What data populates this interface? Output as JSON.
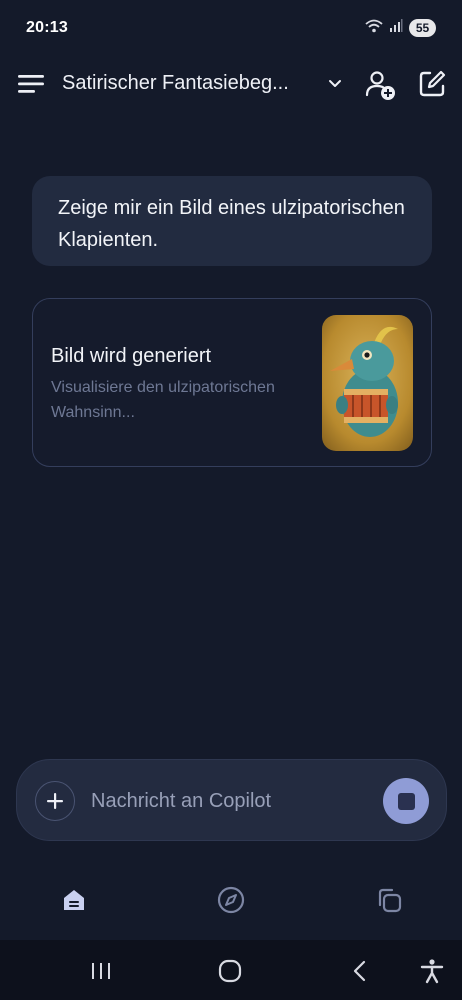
{
  "status_bar": {
    "time": "20:13",
    "battery": "55",
    "icons": [
      "wifi-icon",
      "signal-icon",
      "battery-icon"
    ]
  },
  "header": {
    "title": "Satirischer Fantasiebeg...",
    "icons": [
      "menu-icon",
      "chevron-down-icon",
      "add-person-icon",
      "new-chat-icon"
    ]
  },
  "chat": {
    "user_message": "Zeige mir ein Bild eines ulzipatorischen Klapienten.",
    "generation": {
      "title": "Bild wird generiert",
      "subtitle": "Visualisiere den ulzipatorischen Wahnsinn..."
    }
  },
  "composer": {
    "placeholder": "Nachricht an Copilot",
    "icons": [
      "plus-icon",
      "stop-icon"
    ]
  },
  "bottom_nav": {
    "items": [
      "home-icon",
      "discover-icon",
      "pages-icon"
    ]
  },
  "system_nav": {
    "items": [
      "recents-icon",
      "home-circle-icon",
      "back-icon",
      "accessibility-icon"
    ]
  },
  "colors": {
    "background": "#141a2a",
    "bubble": "#222b40",
    "card_border": "#343e5c",
    "accent": "#8f9cd6",
    "muted_text": "#6e7894"
  }
}
